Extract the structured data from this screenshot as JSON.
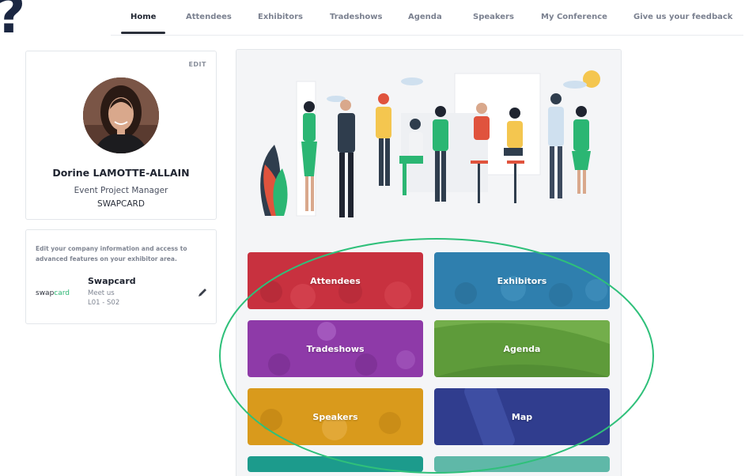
{
  "nav": {
    "items": [
      {
        "label": "Home",
        "active": true
      },
      {
        "label": "Attendees"
      },
      {
        "label": "Exhibitors"
      },
      {
        "label": "Tradeshows"
      },
      {
        "label": "Agenda"
      },
      {
        "label": "Speakers"
      },
      {
        "label": "My Conference"
      },
      {
        "label": "Give us your feedback"
      }
    ]
  },
  "corner": {
    "symbol": "?"
  },
  "profile": {
    "edit_label": "EDIT",
    "name": "Dorine LAMOTTE-ALLAIN",
    "role": "Event Project Manager",
    "company": "SWAPCARD"
  },
  "company_card": {
    "info_text": "Edit your company information and access to advanced features on your exhibitor area.",
    "logo_prefix": "swap",
    "logo_suffix": "card",
    "name": "Swapcard",
    "meet": "Meet us",
    "booth": "L01 - S02"
  },
  "tiles": [
    {
      "label": "Attendees",
      "color": "#c8313f"
    },
    {
      "label": "Exhibitors",
      "color": "#2f7fae"
    },
    {
      "label": "Tradeshows",
      "color": "#8e3aa8"
    },
    {
      "label": "Agenda",
      "color": "#5e9b3a"
    },
    {
      "label": "Speakers",
      "color": "#d99a1c"
    },
    {
      "label": "Map",
      "color": "#303d8e"
    }
  ],
  "colors": {
    "highlight": "#2fc07a",
    "text_dark": "#1f2430",
    "muted": "#7b8190"
  }
}
